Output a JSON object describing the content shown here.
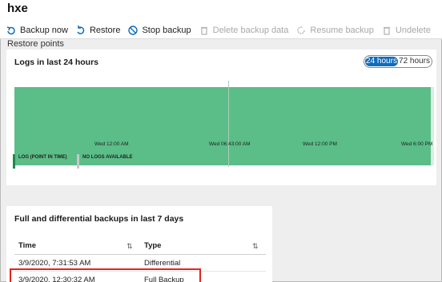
{
  "window": {
    "title": "hxe"
  },
  "toolbar": {
    "items": [
      {
        "label": "Backup now",
        "icon": "backup-icon",
        "disabled": false
      },
      {
        "label": "Restore",
        "icon": "restore-icon",
        "disabled": false
      },
      {
        "label": "Stop backup",
        "icon": "stop-icon",
        "disabled": false
      },
      {
        "label": "Delete backup data",
        "icon": "trash-icon",
        "disabled": true
      },
      {
        "label": "Resume backup",
        "icon": "resume-icon",
        "disabled": true
      },
      {
        "label": "Undelete",
        "icon": "undelete-icon",
        "disabled": true
      }
    ]
  },
  "restore_points": {
    "section_label": "Restore points",
    "logs": {
      "title": "Logs in last 24 hours",
      "toggle": {
        "options": [
          "24 hours",
          "72 hours"
        ],
        "selected": "24 hours"
      },
      "ticks": [
        "Wed 12:00 AM",
        "Wed 06:43:00 AM",
        "Wed 12:00 PM",
        "Wed 6:00 PM"
      ],
      "legend": [
        {
          "label": "LOG (POINT IN TIME)",
          "color": "#1f8a4c"
        },
        {
          "label": "NO LOGS AVAILABLE",
          "color": "#c8c8c8"
        }
      ],
      "bar_color": "#5bbd88"
    }
  },
  "backups": {
    "title": "Full and differential backups in last 7 days",
    "columns": [
      "Time",
      "Type"
    ],
    "rows": [
      {
        "time": "3/9/2020, 7:31:53 AM",
        "type": "Differential"
      },
      {
        "time": "3/9/2020, 12:30:32 AM",
        "type": "Full Backup"
      }
    ],
    "highlight_color": "#e0251e"
  }
}
